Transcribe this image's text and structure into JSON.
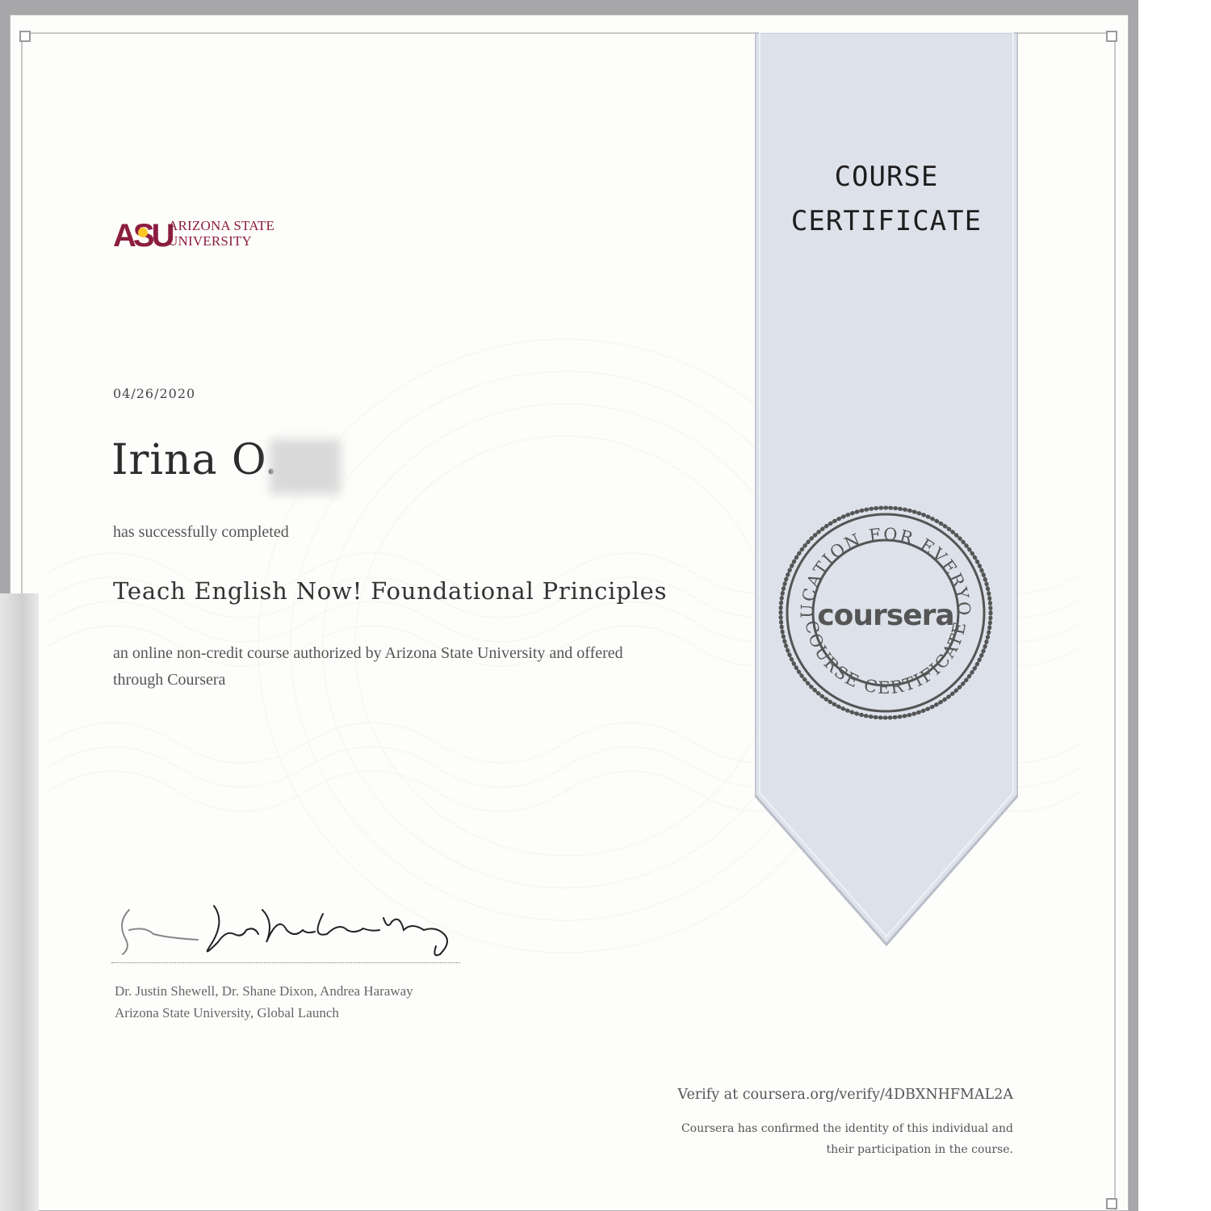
{
  "logo": {
    "university_line1": "ARIZONA STATE",
    "university_line2": "UNIVERSITY",
    "monogram": "ASU",
    "color": "#8c1d40",
    "accent": "#ffc627"
  },
  "certificate": {
    "date": "04/26/2020",
    "recipient_name": "Irina O.",
    "completed_text": "has successfully completed",
    "course_title": "Teach English Now! Foundational Principles",
    "description": "an online non-credit course authorized by Arizona State University and offered through Coursera",
    "signers": "Dr. Justin Shewell, Dr. Shane Dixon, Andrea Haraway",
    "signer_org": "Arizona State University, Global Launch"
  },
  "ribbon": {
    "title_line1": "COURSE",
    "title_line2": "CERTIFICATE",
    "color": "#dde2ea"
  },
  "seal": {
    "top_arc_text": "EDUCATION FOR EVERYONE",
    "bottom_arc_text": "COURSE CERTIFICATE",
    "brand": "coursera",
    "color": "#555555"
  },
  "footer": {
    "verify_text": "Verify at coursera.org/verify/4DBXNHFMAL2A",
    "confirm_line1": "Coursera has confirmed the identity of this individual and",
    "confirm_line2": "their participation in the course."
  }
}
